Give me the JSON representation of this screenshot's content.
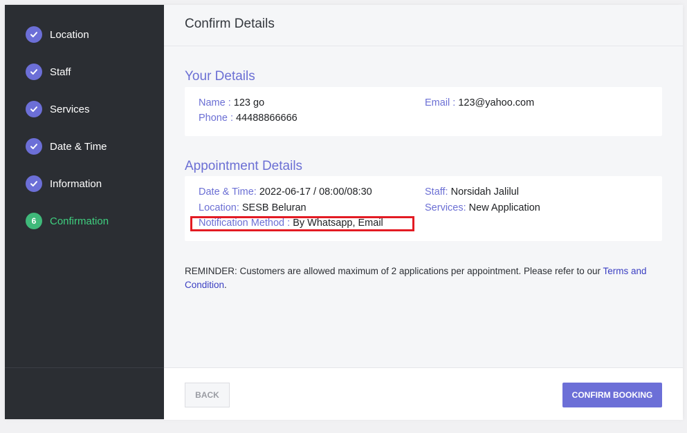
{
  "steps": [
    {
      "number": "1",
      "label": "Location",
      "state": "done"
    },
    {
      "number": "2",
      "label": "Staff",
      "state": "done"
    },
    {
      "number": "3",
      "label": "Services",
      "state": "done"
    },
    {
      "number": "4",
      "label": "Date & Time",
      "state": "done"
    },
    {
      "number": "5",
      "label": "Information",
      "state": "done"
    },
    {
      "number": "6",
      "label": "Confirmation",
      "state": "active"
    }
  ],
  "header": {
    "title": "Confirm Details"
  },
  "your_details": {
    "title": "Your Details",
    "name_label": "Name :",
    "name_value": "123 go",
    "phone_label": "Phone :",
    "phone_value": "44488866666",
    "email_label": "Email :",
    "email_value": "123@yahoo.com"
  },
  "appointment": {
    "title": "Appointment Details",
    "datetime_label": "Date & Time:",
    "datetime_value": "2022-06-17 / 08:00/08:30",
    "location_label": "Location:",
    "location_value": "SESB Beluran",
    "notification_label": "Notification Method :",
    "notification_value": "By Whatsapp, Email",
    "staff_label": "Staff:",
    "staff_value": "Norsidah Jalilul",
    "services_label": "Services:",
    "services_value": "New Application"
  },
  "reminder": {
    "text": "REMINDER: Customers are allowed maximum of 2 applications per appointment. Please refer to our",
    "link": "Terms and Condition",
    "end": "."
  },
  "footer": {
    "back_label": "BACK",
    "confirm_label": "CONFIRM BOOKING"
  },
  "colors": {
    "accent": "#6c6fd7",
    "active": "#3fb97a",
    "sidebar": "#2b2e33",
    "highlight": "#e31b23"
  }
}
